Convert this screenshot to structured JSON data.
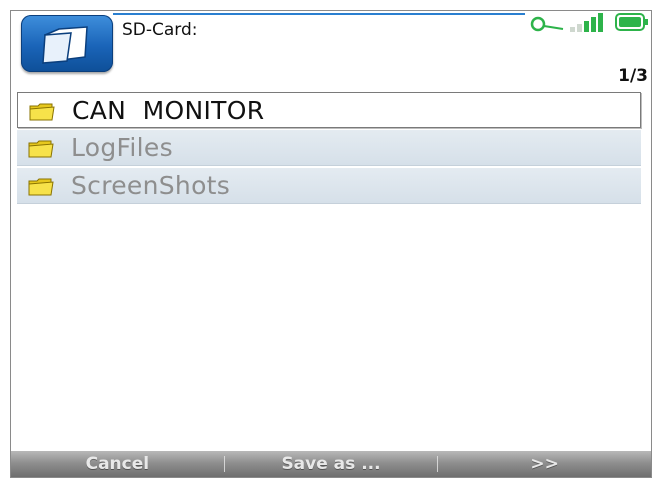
{
  "header": {
    "title": "SD-Card:",
    "page_indicator": "1/3"
  },
  "status": {
    "icons": [
      "connection-icon",
      "signal-strength-icon",
      "battery-icon"
    ]
  },
  "file_list": {
    "items": [
      {
        "label": "CAN  MONITOR",
        "selected": true,
        "icon": "folder-icon"
      },
      {
        "label": "LogFiles",
        "selected": false,
        "icon": "folder-icon"
      },
      {
        "label": "ScreenShots",
        "selected": false,
        "icon": "folder-icon"
      }
    ]
  },
  "softkeys": {
    "cancel": "Cancel",
    "save_as": "Save as ...",
    "next": ">>"
  },
  "colors": {
    "accent_blue": "#2a7fd0",
    "status_green": "#2db34a",
    "row_bg": "#dde6ee",
    "softkey_bar": "#8f8f8f"
  }
}
